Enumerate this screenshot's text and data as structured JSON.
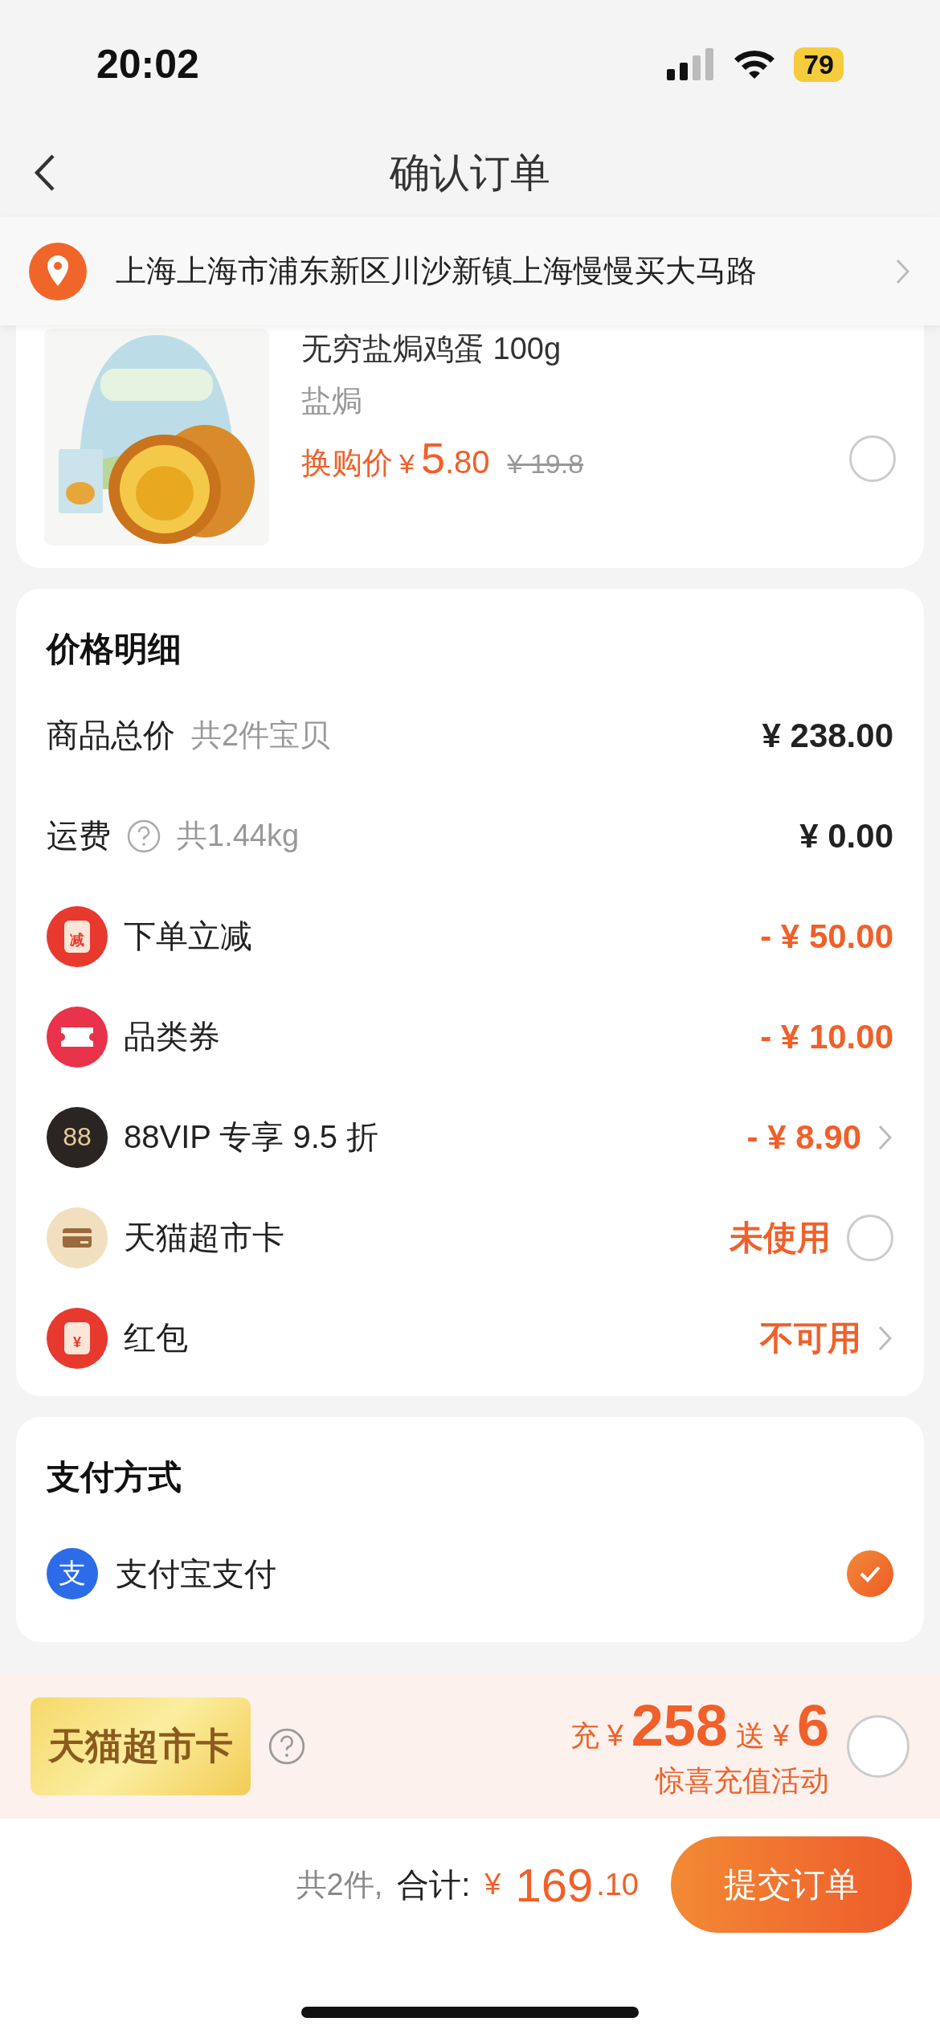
{
  "status_bar": {
    "time": "20:02",
    "battery": "79"
  },
  "nav": {
    "title": "确认订单"
  },
  "address": {
    "text": "上海上海市浦东新区川沙新镇上海慢慢买大马路"
  },
  "product": {
    "title": "无穷盐焗鸡蛋 100g",
    "spec": "盐焗",
    "price_label": "换购价",
    "currency": "¥",
    "price_int": "5",
    "price_dec": ".80",
    "original_price": "¥ 19.8",
    "selected": false
  },
  "price_details": {
    "title": "价格明细",
    "rows": [
      {
        "kind": "total",
        "label": "商品总价",
        "note": "共2件宝贝",
        "value": "¥ 238.00"
      },
      {
        "kind": "shipping",
        "label": "运费",
        "note": "共1.44kg",
        "value": "¥ 0.00"
      },
      {
        "kind": "reduction",
        "badge": "减",
        "label": "下单立减",
        "value": "- ¥ 50.00"
      },
      {
        "kind": "coupon",
        "label": "品类券",
        "value": "- ¥ 10.00"
      },
      {
        "kind": "vip",
        "badge": "88",
        "label": "88VIP 专享 9.5 折",
        "value": "- ¥ 8.90"
      },
      {
        "kind": "card",
        "label": "天猫超市卡",
        "value": "未使用",
        "selected": false
      },
      {
        "kind": "redpacket",
        "badge": "¥",
        "label": "红包",
        "value": "不可用"
      }
    ]
  },
  "payment": {
    "title": "支付方式",
    "methods": [
      {
        "badge": "支",
        "label": "支付宝支付",
        "selected": true
      }
    ]
  },
  "promo": {
    "card_label": "天猫超市卡",
    "charge_label": "充",
    "charge_currency": "¥",
    "charge_amount": "258",
    "bonus_label": "送",
    "bonus_currency": "¥",
    "bonus_amount": "6",
    "subtitle": "惊喜充值活动",
    "selected": false
  },
  "footer": {
    "count": "共2件,",
    "total_label": "合计:",
    "currency": "¥",
    "total_int": "169",
    "total_dec": ".10",
    "submit": "提交订单"
  }
}
